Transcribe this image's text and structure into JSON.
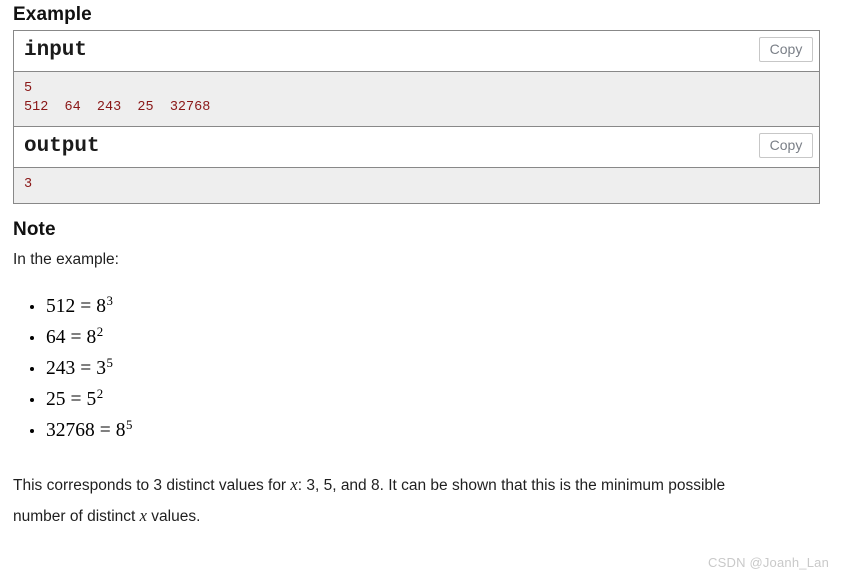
{
  "headings": {
    "example": "Example",
    "note": "Note"
  },
  "sample_tests": [
    {
      "title": "input",
      "copy_label": "Copy",
      "content": "5\n512  64  243  25  32768"
    },
    {
      "title": "output",
      "copy_label": "Copy",
      "content": "3"
    }
  ],
  "note": {
    "intro": "In the example:",
    "equations": [
      {
        "left": "512",
        "op": "=",
        "base": "8",
        "exp": "3"
      },
      {
        "left": "64",
        "op": "=",
        "base": "8",
        "exp": "2"
      },
      {
        "left": "243",
        "op": "=",
        "base": "3",
        "exp": "5"
      },
      {
        "left": "25",
        "op": "=",
        "base": "5",
        "exp": "2"
      },
      {
        "left": "32768",
        "op": "=",
        "base": "8",
        "exp": "5"
      }
    ],
    "paragraph": {
      "part1": "This corresponds to 3 distinct values for ",
      "var1": "x",
      "part2": ": 3, 5, and 8. It can be shown that this is the minimum possible number of distinct ",
      "var2": "x",
      "part3": " values."
    }
  },
  "watermark": "CSDN @Joanh_Lan"
}
